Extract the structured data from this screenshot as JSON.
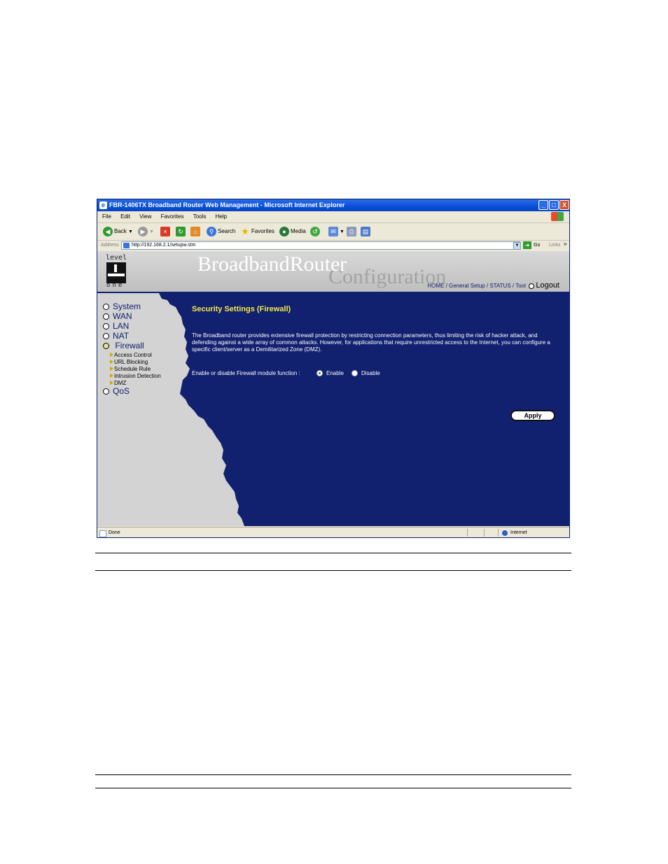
{
  "window": {
    "title": "FBR-1406TX Broadband Router Web Management - Microsoft Internet Explorer",
    "minimize": "_",
    "maximize": "□",
    "close": "X"
  },
  "menu": [
    "File",
    "Edit",
    "View",
    "Favorites",
    "Tools",
    "Help"
  ],
  "toolbar": {
    "back": "Back",
    "search": "Search",
    "favorites": "Favorites",
    "media": "Media"
  },
  "address": {
    "label": "Address",
    "url": "http://192.168.2.1/setupw.stm",
    "go": "Go",
    "links": "Links"
  },
  "header": {
    "logo_top": "level",
    "logo_bottom": "one",
    "brand_line1": "BroadbandRouter",
    "brand_line2": "Configuration",
    "links": [
      "HOME",
      "General Setup",
      "STATUS",
      "Tool"
    ],
    "logout": "Logout"
  },
  "nav": {
    "items": [
      "System",
      "WAN",
      "LAN",
      "NAT",
      "Firewall",
      "QoS"
    ],
    "firewall_sub": [
      "Access Control",
      "URL Blocking",
      "Schedule Rule",
      "Intrusion Detection",
      "DMZ"
    ]
  },
  "main": {
    "title": "Security Settings (Firewall)",
    "description": "The Broadband router provides extensive firewall protection by restricting connection parameters, thus limiting the risk of hacker attack, and defending against a wide array of common attacks. However, for applications that require unrestricted access to the Internet, you can configure a specific client/server as a Demilitarized Zone (DMZ).",
    "fw_label": "Enable or disable Firewall module function :",
    "enable": "Enable",
    "disable": "Disable",
    "selected": "Enable",
    "apply": "Apply"
  },
  "status": {
    "left": "Done",
    "zone": "Internet"
  },
  "colors": {
    "navy": "#11206f",
    "title_yellow": "#f5e84a",
    "side_gray": "#d3d3d3"
  }
}
